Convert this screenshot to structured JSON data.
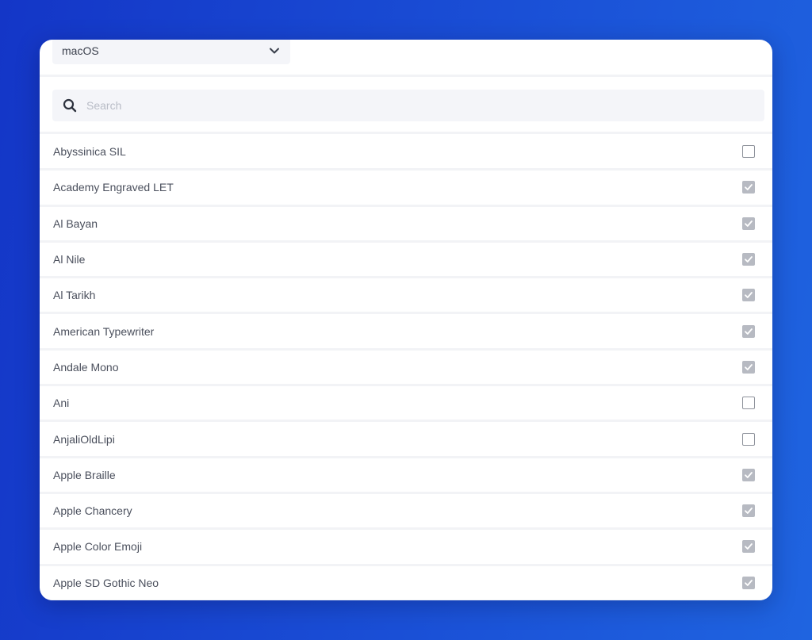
{
  "os_select": {
    "value": "macOS",
    "icon": "chevron-down-icon"
  },
  "search": {
    "placeholder": "Search",
    "value": "",
    "icon": "search-icon"
  },
  "fonts": [
    {
      "name": "Abyssinica SIL",
      "checked": false
    },
    {
      "name": "Academy Engraved LET",
      "checked": true
    },
    {
      "name": "Al Bayan",
      "checked": true
    },
    {
      "name": "Al Nile",
      "checked": true
    },
    {
      "name": "Al Tarikh",
      "checked": true
    },
    {
      "name": "American Typewriter",
      "checked": true
    },
    {
      "name": "Andale Mono",
      "checked": true
    },
    {
      "name": "Ani",
      "checked": false
    },
    {
      "name": "AnjaliOldLipi",
      "checked": false
    },
    {
      "name": "Apple Braille",
      "checked": true
    },
    {
      "name": "Apple Chancery",
      "checked": true
    },
    {
      "name": "Apple Color Emoji",
      "checked": true
    },
    {
      "name": "Apple SD Gothic Neo",
      "checked": true
    }
  ],
  "colors": {
    "background_start": "#1436c7",
    "background_end": "#1f64e0",
    "checked_box": "#b7bac2",
    "text": "#4a4f5c"
  }
}
